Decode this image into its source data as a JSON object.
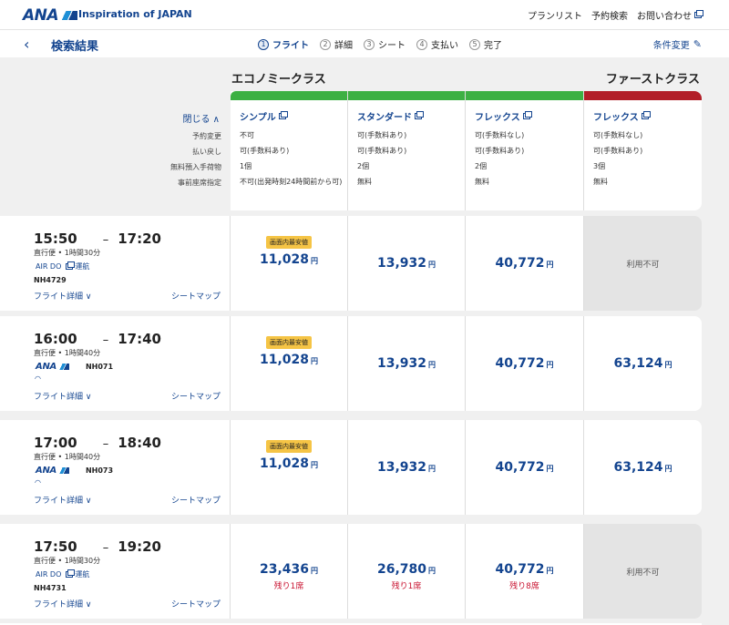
{
  "header": {
    "brand": "ANA",
    "tagline": "Inspiration of JAPAN",
    "links": [
      "プランリスト",
      "予約検索",
      "お問い合わせ"
    ]
  },
  "subheader": {
    "title": "検索結果",
    "steps": [
      {
        "num": "1",
        "label": "フライト"
      },
      {
        "num": "2",
        "label": "詳細"
      },
      {
        "num": "3",
        "label": "シート"
      },
      {
        "num": "4",
        "label": "支払い"
      },
      {
        "num": "5",
        "label": "完了"
      }
    ],
    "condition_change": "条件変更"
  },
  "classes": {
    "economy": "エコノミークラス",
    "first": "ファーストクラス"
  },
  "fare_table": {
    "close_label": "閉じる ∧",
    "row_labels": [
      "予約変更",
      "払い戻し",
      "無料預入手荷物",
      "事前座席指定"
    ],
    "fares": [
      {
        "name": "シンプル",
        "color": "#3cb043",
        "rows": [
          "不可",
          "可(手数料あり)",
          "1個",
          "不可(出発時刻24時間前から可)"
        ]
      },
      {
        "name": "スタンダード",
        "color": "#3cb043",
        "rows": [
          "可(手数料あり)",
          "可(手数料あり)",
          "2個",
          "無料"
        ]
      },
      {
        "name": "フレックス",
        "color": "#3cb043",
        "rows": [
          "可(手数料なし)",
          "可(手数料あり)",
          "2個",
          "無料"
        ]
      },
      {
        "name": "フレックス",
        "color": "#b21e28",
        "rows": [
          "可(手数料なし)",
          "可(手数料あり)",
          "3個",
          "無料"
        ]
      }
    ]
  },
  "flights": [
    {
      "dep": "15:50",
      "arr": "17:20",
      "duration": "直行便 • 1時間30分",
      "carrier": "AIR DO",
      "operated": "運航",
      "flight_no": "NH4729",
      "detail": "フライト詳細 ∨",
      "seatmap": "シートマップ",
      "badge": "画面内最安値",
      "prices": [
        "11,028",
        "13,932",
        "40,772"
      ],
      "first": "利用不可"
    },
    {
      "dep": "16:00",
      "arr": "17:40",
      "duration": "直行便 • 1時間40分",
      "carrier": "ANA",
      "flight_no": "NH071",
      "detail": "フライト詳細 ∨",
      "seatmap": "シートマップ",
      "badge": "画面内最安値",
      "prices": [
        "11,028",
        "13,932",
        "40,772"
      ],
      "first": "63,124"
    },
    {
      "dep": "17:00",
      "arr": "18:40",
      "duration": "直行便 • 1時間40分",
      "carrier": "ANA",
      "flight_no": "NH073",
      "detail": "フライト詳細 ∨",
      "seatmap": "シートマップ",
      "badge": "画面内最安値",
      "prices": [
        "11,028",
        "13,932",
        "40,772"
      ],
      "first": "63,124"
    },
    {
      "dep": "17:50",
      "arr": "19:20",
      "duration": "直行便 • 1時間30分",
      "carrier": "AIR DO",
      "operated": "運航",
      "flight_no": "NH4731",
      "detail": "フライト詳細 ∨",
      "seatmap": "シートマップ",
      "prices": [
        "23,436",
        "26,780",
        "40,772"
      ],
      "remaining": [
        "残り1席",
        "残り1席",
        "残り8席"
      ],
      "first": "利用不可"
    }
  ],
  "currency": "円",
  "icons": [
    "back-arrow-icon",
    "external-link-icon",
    "pencil-icon",
    "wifi-icon",
    "chevron-down-icon"
  ]
}
